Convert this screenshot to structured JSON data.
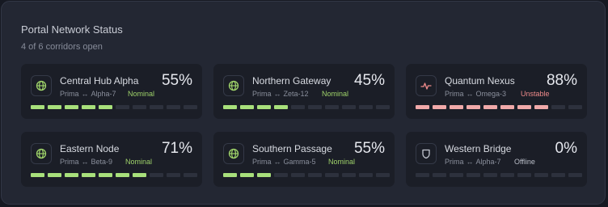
{
  "header": {
    "title": "Portal Network Status",
    "subtitle": "4 of 6 corridors open"
  },
  "colors": {
    "nominal": "#9fd36a",
    "unstable": "#ee8a8a",
    "offline": "#b9bdc7",
    "bar_green": "#a8e07b",
    "bar_red": "#f0a9a9",
    "bar_empty": "#2d313d"
  },
  "corridors": [
    {
      "name": "Central Hub Alpha",
      "from": "Prima",
      "arrow": "↔",
      "to": "Alpha-7",
      "status": "Nominal",
      "percent_label": "55%",
      "filled_segments": 5,
      "total_segments": 10,
      "icon": "globe-icon"
    },
    {
      "name": "Northern Gateway",
      "from": "Prima",
      "arrow": "↔",
      "to": "Zeta-12",
      "status": "Nominal",
      "percent_label": "45%",
      "filled_segments": 4,
      "total_segments": 10,
      "icon": "globe-icon"
    },
    {
      "name": "Quantum Nexus",
      "from": "Prima",
      "arrow": "↔",
      "to": "Omega-3",
      "status": "Unstable",
      "percent_label": "88%",
      "filled_segments": 8,
      "total_segments": 10,
      "icon": "pulse-icon"
    },
    {
      "name": "Eastern Node",
      "from": "Prima",
      "arrow": "↔",
      "to": "Beta-9",
      "status": "Nominal",
      "percent_label": "71%",
      "filled_segments": 7,
      "total_segments": 10,
      "icon": "globe-icon"
    },
    {
      "name": "Southern Passage",
      "from": "Prima",
      "arrow": "↔",
      "to": "Gamma-5",
      "status": "Nominal",
      "percent_label": "55%",
      "filled_segments": 3,
      "total_segments": 10,
      "icon": "globe-icon"
    },
    {
      "name": "Western Bridge",
      "from": "Prima",
      "arrow": "↔",
      "to": "Alpha-7",
      "status": "Offline",
      "percent_label": "0%",
      "filled_segments": 0,
      "total_segments": 10,
      "icon": "shield-icon"
    }
  ]
}
